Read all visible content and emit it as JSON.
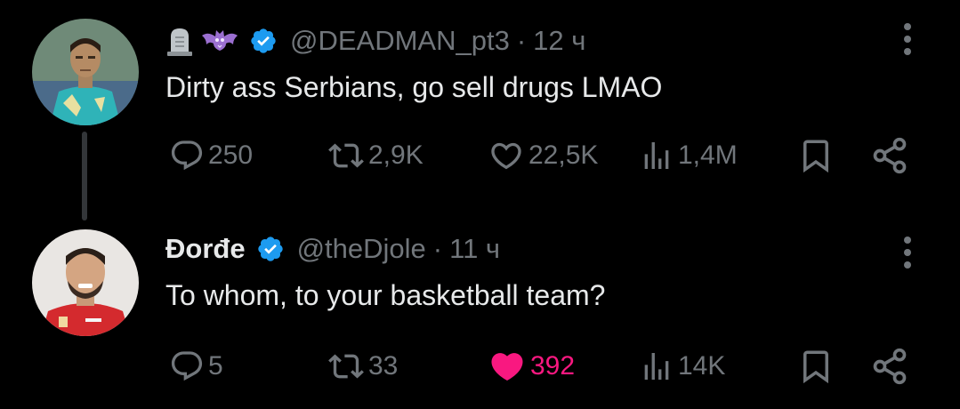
{
  "tweets": [
    {
      "display_name": "",
      "handle": "@DEADMAN_pt3",
      "separator": "·",
      "time": "12 ч",
      "text": "Dirty ass Serbians, go sell drugs LMAO",
      "stats": {
        "replies": "250",
        "reposts": "2,9K",
        "likes": "22,5K",
        "views": "1,4M"
      },
      "liked": false,
      "emojis": [
        "headstone-icon",
        "bat-icon"
      ],
      "verified": true
    },
    {
      "display_name": "Đorđe",
      "handle": "@theDjole",
      "separator": "·",
      "time": "11 ч",
      "text": "To whom, to your basketball team?",
      "stats": {
        "replies": "5",
        "reposts": "33",
        "likes": "392",
        "views": "14K"
      },
      "liked": true,
      "verified": true
    }
  ],
  "colors": {
    "background": "#000000",
    "text": "#e7e9ea",
    "muted": "#71767b",
    "verified": "#1d9bf0",
    "like_active": "#f91880"
  }
}
